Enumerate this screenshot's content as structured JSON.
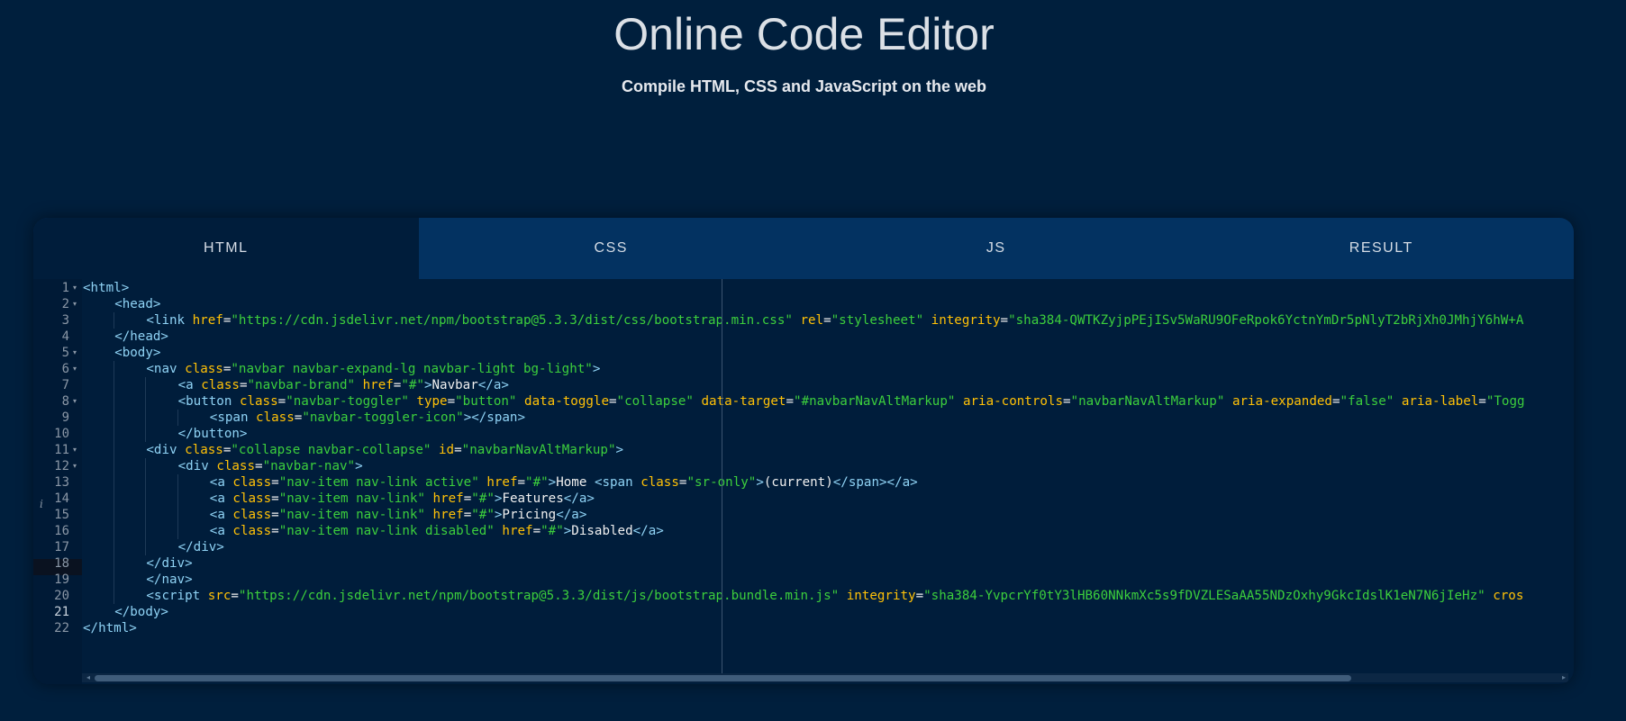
{
  "header": {
    "title": "Online Code Editor",
    "subtitle": "Compile HTML, CSS and JavaScript on the web"
  },
  "tabs": [
    {
      "label": "HTML",
      "active": true
    },
    {
      "label": "CSS",
      "active": false
    },
    {
      "label": "JS",
      "active": false
    },
    {
      "label": "RESULT",
      "active": false
    }
  ],
  "editor": {
    "active_line": 21,
    "info_marker": "i",
    "lines": [
      {
        "n": "1",
        "fold": true,
        "indent": 0,
        "tokens": [
          [
            "t",
            "<html>"
          ]
        ]
      },
      {
        "n": "2",
        "fold": true,
        "indent": 1,
        "tokens": [
          [
            "t",
            "<head>"
          ]
        ]
      },
      {
        "n": "3",
        "fold": false,
        "indent": 2,
        "tokens": [
          [
            "t",
            "<link "
          ],
          [
            "a",
            "href"
          ],
          [
            "x",
            "="
          ],
          [
            "s",
            "\"https://cdn.jsdelivr.net/npm/bootstrap@5.3.3/dist/css/bootstrap.min.css\""
          ],
          [
            "x",
            " "
          ],
          [
            "a",
            "rel"
          ],
          [
            "x",
            "="
          ],
          [
            "s",
            "\"stylesheet\""
          ],
          [
            "x",
            " "
          ],
          [
            "a",
            "integrity"
          ],
          [
            "x",
            "="
          ],
          [
            "s",
            "\"sha384-QWTKZyjpPEjISv5WaRU9OFeRpok6YctnYmDr5pNlyT2bRjXh0JMhjY6hW+A"
          ]
        ]
      },
      {
        "n": "4",
        "fold": false,
        "indent": 1,
        "tokens": [
          [
            "t",
            "</head>"
          ]
        ]
      },
      {
        "n": "5",
        "fold": true,
        "indent": 1,
        "tokens": [
          [
            "t",
            "<body>"
          ]
        ]
      },
      {
        "n": "6",
        "fold": true,
        "indent": 2,
        "tokens": [
          [
            "t",
            "<nav "
          ],
          [
            "a",
            "class"
          ],
          [
            "x",
            "="
          ],
          [
            "s",
            "\"navbar navbar-expand-lg navbar-light bg-light\""
          ],
          [
            "t",
            ">"
          ]
        ]
      },
      {
        "n": "7",
        "fold": false,
        "indent": 3,
        "tokens": [
          [
            "t",
            "<a "
          ],
          [
            "a",
            "class"
          ],
          [
            "x",
            "="
          ],
          [
            "s",
            "\"navbar-brand\""
          ],
          [
            "x",
            " "
          ],
          [
            "a",
            "href"
          ],
          [
            "x",
            "="
          ],
          [
            "s",
            "\"#\""
          ],
          [
            "t",
            ">"
          ],
          [
            "x",
            "Navbar"
          ],
          [
            "t",
            "</a>"
          ]
        ]
      },
      {
        "n": "8",
        "fold": true,
        "indent": 3,
        "tokens": [
          [
            "t",
            "<button "
          ],
          [
            "a",
            "class"
          ],
          [
            "x",
            "="
          ],
          [
            "s",
            "\"navbar-toggler\""
          ],
          [
            "x",
            " "
          ],
          [
            "a",
            "type"
          ],
          [
            "x",
            "="
          ],
          [
            "s",
            "\"button\""
          ],
          [
            "x",
            " "
          ],
          [
            "a",
            "data-toggle"
          ],
          [
            "x",
            "="
          ],
          [
            "s",
            "\"collapse\""
          ],
          [
            "x",
            " "
          ],
          [
            "a",
            "data-target"
          ],
          [
            "x",
            "="
          ],
          [
            "s",
            "\"#navbarNavAltMarkup\""
          ],
          [
            "x",
            " "
          ],
          [
            "a",
            "aria-controls"
          ],
          [
            "x",
            "="
          ],
          [
            "s",
            "\"navbarNavAltMarkup\""
          ],
          [
            "x",
            " "
          ],
          [
            "a",
            "aria-expanded"
          ],
          [
            "x",
            "="
          ],
          [
            "s",
            "\"false\""
          ],
          [
            "x",
            " "
          ],
          [
            "a",
            "aria-label"
          ],
          [
            "x",
            "="
          ],
          [
            "s",
            "\"Togg"
          ]
        ]
      },
      {
        "n": "9",
        "fold": false,
        "indent": 4,
        "tokens": [
          [
            "t",
            "<span "
          ],
          [
            "a",
            "class"
          ],
          [
            "x",
            "="
          ],
          [
            "s",
            "\"navbar-toggler-icon\""
          ],
          [
            "t",
            "></span>"
          ]
        ]
      },
      {
        "n": "10",
        "fold": false,
        "indent": 3,
        "tokens": [
          [
            "t",
            "</button>"
          ]
        ]
      },
      {
        "n": "11",
        "fold": true,
        "indent": 2,
        "tokens": [
          [
            "t",
            "<div "
          ],
          [
            "a",
            "class"
          ],
          [
            "x",
            "="
          ],
          [
            "s",
            "\"collapse navbar-collapse\""
          ],
          [
            "x",
            " "
          ],
          [
            "a",
            "id"
          ],
          [
            "x",
            "="
          ],
          [
            "s",
            "\"navbarNavAltMarkup\""
          ],
          [
            "t",
            ">"
          ]
        ]
      },
      {
        "n": "12",
        "fold": true,
        "indent": 3,
        "tokens": [
          [
            "t",
            "<div "
          ],
          [
            "a",
            "class"
          ],
          [
            "x",
            "="
          ],
          [
            "s",
            "\"navbar-nav\""
          ],
          [
            "t",
            ">"
          ]
        ]
      },
      {
        "n": "13",
        "fold": false,
        "indent": 4,
        "tokens": [
          [
            "t",
            "<a "
          ],
          [
            "a",
            "class"
          ],
          [
            "x",
            "="
          ],
          [
            "s",
            "\"nav-item nav-link active\""
          ],
          [
            "x",
            " "
          ],
          [
            "a",
            "href"
          ],
          [
            "x",
            "="
          ],
          [
            "s",
            "\"#\""
          ],
          [
            "t",
            ">"
          ],
          [
            "x",
            "Home "
          ],
          [
            "t",
            "<span "
          ],
          [
            "a",
            "class"
          ],
          [
            "x",
            "="
          ],
          [
            "s",
            "\"sr-only\""
          ],
          [
            "t",
            ">"
          ],
          [
            "x",
            "(current)"
          ],
          [
            "t",
            "</span></a>"
          ]
        ]
      },
      {
        "n": "14",
        "fold": false,
        "indent": 4,
        "tokens": [
          [
            "t",
            "<a "
          ],
          [
            "a",
            "class"
          ],
          [
            "x",
            "="
          ],
          [
            "s",
            "\"nav-item nav-link\""
          ],
          [
            "x",
            " "
          ],
          [
            "a",
            "href"
          ],
          [
            "x",
            "="
          ],
          [
            "s",
            "\"#\""
          ],
          [
            "t",
            ">"
          ],
          [
            "x",
            "Features"
          ],
          [
            "t",
            "</a>"
          ]
        ]
      },
      {
        "n": "15",
        "fold": false,
        "indent": 4,
        "tokens": [
          [
            "t",
            "<a "
          ],
          [
            "a",
            "class"
          ],
          [
            "x",
            "="
          ],
          [
            "s",
            "\"nav-item nav-link\""
          ],
          [
            "x",
            " "
          ],
          [
            "a",
            "href"
          ],
          [
            "x",
            "="
          ],
          [
            "s",
            "\"#\""
          ],
          [
            "t",
            ">"
          ],
          [
            "x",
            "Pricing"
          ],
          [
            "t",
            "</a>"
          ]
        ]
      },
      {
        "n": "16",
        "fold": false,
        "indent": 4,
        "tokens": [
          [
            "t",
            "<a "
          ],
          [
            "a",
            "class"
          ],
          [
            "x",
            "="
          ],
          [
            "s",
            "\"nav-item nav-link disabled\""
          ],
          [
            "x",
            " "
          ],
          [
            "a",
            "href"
          ],
          [
            "x",
            "="
          ],
          [
            "s",
            "\"#\""
          ],
          [
            "t",
            ">"
          ],
          [
            "x",
            "Disabled"
          ],
          [
            "t",
            "</a>"
          ]
        ]
      },
      {
        "n": "17",
        "fold": false,
        "indent": 3,
        "tokens": [
          [
            "t",
            "</div>"
          ]
        ]
      },
      {
        "n": "18",
        "fold": false,
        "indent": 2,
        "tokens": [
          [
            "t",
            "</div>"
          ]
        ]
      },
      {
        "n": "19",
        "fold": false,
        "indent": 2,
        "tokens": [
          [
            "t",
            "</nav>"
          ]
        ]
      },
      {
        "n": "20",
        "fold": false,
        "indent": 2,
        "tokens": [
          [
            "t",
            "<script "
          ],
          [
            "a",
            "src"
          ],
          [
            "x",
            "="
          ],
          [
            "s",
            "\"https://cdn.jsdelivr.net/npm/bootstrap@5.3.3/dist/js/bootstrap.bundle.min.js\""
          ],
          [
            "x",
            " "
          ],
          [
            "a",
            "integrity"
          ],
          [
            "x",
            "="
          ],
          [
            "s",
            "\"sha384-YvpcrYf0tY3lHB60NNkmXc5s9fDVZLESaAA55NDzOxhy9GkcIdslK1eN7N6jIeHz\""
          ],
          [
            "x",
            " "
          ],
          [
            "a",
            "cros"
          ]
        ]
      },
      {
        "n": "21",
        "fold": false,
        "indent": 1,
        "tokens": [
          [
            "t",
            "</body>"
          ]
        ]
      },
      {
        "n": "22",
        "fold": false,
        "indent": 0,
        "tokens": [
          [
            "t",
            "</html>"
          ]
        ]
      }
    ]
  },
  "colors": {
    "background": "#001f3d",
    "tab_bar": "#033261",
    "tag": "#8fd3f5",
    "attribute": "#ffc107",
    "string": "#3ccf3c",
    "text": "#f0f0f0"
  }
}
